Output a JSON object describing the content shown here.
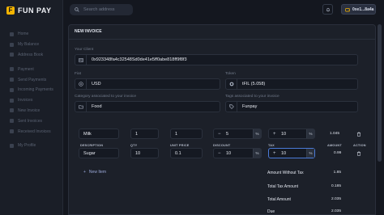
{
  "brand": {
    "name": "FUN PAY",
    "mark": "F"
  },
  "sidebar": {
    "items": [
      "Home",
      "My Balance",
      "Address Book",
      "Payment",
      "Send Payments",
      "Incoming Payments",
      "Invoices",
      "New Invoice",
      "Sent Invoices",
      "Received Invoices",
      "My Profile"
    ]
  },
  "header": {
    "search_placeholder": "Search address",
    "wallet_label": "0xe1...8a4a"
  },
  "invoice": {
    "title": "NEW INVOICE",
    "client_label": "Your Client",
    "client_address": "0x923348fa4c32548Sd0de41e5ff0abe818ff9f8f3",
    "fiat_label": "Fiat",
    "fiat_value": "USD",
    "token_label": "Token",
    "token_value": "tFIL (5.058)",
    "category_label": "Category associated to your invoice",
    "category_value": "Food",
    "tags_label": "Tags associated to your invoice",
    "tags_value": "Funpay"
  },
  "table": {
    "headers": {
      "description": "DESCRIPTION",
      "qty": "QTY",
      "unit_price": "UNIT PRICE",
      "discount": "DISCOUNT",
      "tax": "TAX",
      "amount": "AMOUNT",
      "action": "ACTION"
    },
    "rows": [
      {
        "description": "Milk",
        "qty": "1",
        "unit_price": "1",
        "discount": "5",
        "tax": "10",
        "amount": "1.045"
      },
      {
        "description": "Sugar",
        "qty": "10",
        "unit_price": "0.1",
        "discount": "10",
        "tax": "10",
        "amount": "0.99"
      }
    ],
    "percent_symbol": "%",
    "minus_symbol": "−",
    "plus_symbol": "+",
    "new_item_label": "New Item"
  },
  "summary": {
    "amount_without_tax_label": "Amount Without Tax",
    "amount_without_tax_value": "1.85",
    "total_tax_label": "Total Tax Amount",
    "total_tax_value": "0.185",
    "total_amount_label": "Total Amount",
    "total_amount_value": "2.035",
    "due_label": "Due",
    "due_value": "2.035"
  },
  "colors": {
    "accent": "#f4b400",
    "focus": "#4b7bd8",
    "background": "#14171f",
    "panel": "#1c2029"
  }
}
